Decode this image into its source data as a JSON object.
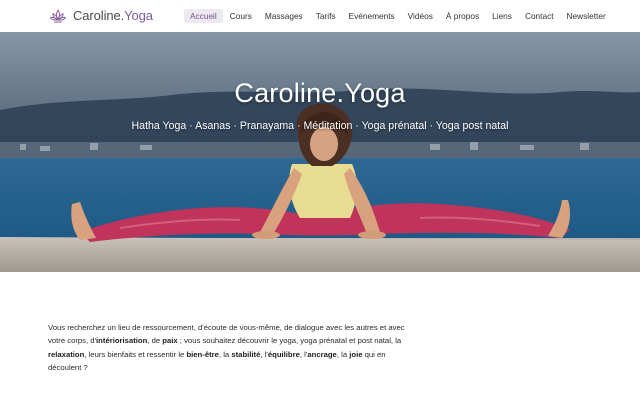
{
  "header": {
    "logo": {
      "part1": "Caroline.",
      "part2": "Yoga",
      "icon": "lotus-icon"
    },
    "nav": [
      {
        "label": "Accueil",
        "active": true
      },
      {
        "label": "Cours"
      },
      {
        "label": "Massages"
      },
      {
        "label": "Tarifs"
      },
      {
        "label": "Evénements"
      },
      {
        "label": "Vidéos"
      },
      {
        "label": "À propos"
      },
      {
        "label": "Liens"
      },
      {
        "label": "Contact"
      },
      {
        "label": "Newsletter"
      }
    ]
  },
  "hero": {
    "title": "Caroline.Yoga",
    "subtitle": "Hatha Yoga · Asanas · Pranayama · Méditation · Yoga prénatal · Yoga post natal"
  },
  "intro": {
    "t1": "Vous recherchez un lieu de ressourcement, d'écoute de vous-même, de dialogue avec les autres et avec votre corps, d'",
    "b1": "intériorisation",
    "t2": ", de ",
    "b2": "paix",
    "t3": " ; vous souhaitez découvrir le yoga, yoga prénatal et post natal, la ",
    "b3": "relaxation",
    "t4": ", leurs bienfaits et ressentir le ",
    "b4": "bien-être",
    "t5": ", la ",
    "b5": "stabilité",
    "t6": ", l'",
    "b6": "équilibre",
    "t7": ", l'",
    "b7": "ancrage",
    "t8": ", la ",
    "b8": "joie",
    "t9": " qui en découlent ?"
  },
  "colors": {
    "accent": "#7a4f8f",
    "active_bg": "#ece9ef",
    "logo_accent": "#7a5a9a"
  }
}
